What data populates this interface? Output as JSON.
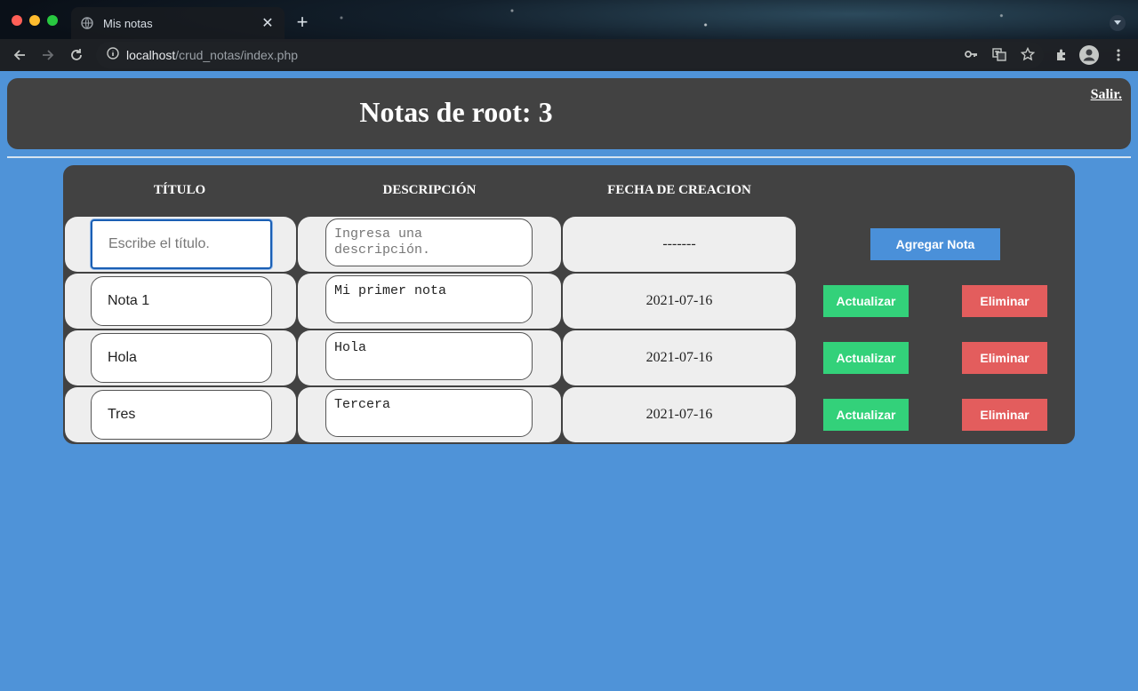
{
  "browser": {
    "tab_title": "Mis notas",
    "tab_close": "✕",
    "new_tab": "+",
    "url_host": "localhost",
    "url_path": "/crud_notas/index.php"
  },
  "header": {
    "title": "Notas de root: 3",
    "logout": "Salir."
  },
  "table": {
    "columns": [
      "TÍTULO",
      "DESCRIPCIÓN",
      "FECHA DE CREACION"
    ],
    "new_row": {
      "title_placeholder": "Escribe el título.",
      "description_placeholder": "Ingresa una descripción.",
      "date": "-------",
      "add_label": "Agregar Nota"
    },
    "rows": [
      {
        "title": "Nota 1",
        "description": "Mi primer nota",
        "date": "2021-07-16"
      },
      {
        "title": "Hola",
        "description": "Hola",
        "date": "2021-07-16"
      },
      {
        "title": "Tres",
        "description": "Tercera",
        "date": "2021-07-16"
      }
    ],
    "update_label": "Actualizar",
    "delete_label": "Eliminar"
  },
  "colors": {
    "page_bg": "#4f93d8",
    "panel_bg": "#424242",
    "cell_bg": "#eeeeee",
    "add_button": "#4a90d9",
    "update_button": "#33d17a",
    "delete_button": "#e35d5d"
  }
}
